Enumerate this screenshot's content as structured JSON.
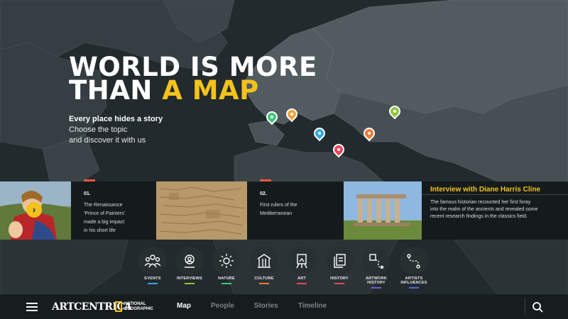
{
  "hero": {
    "title_line1": "WORLD IS MORE",
    "title_line2_prefix": "THAN",
    "title_line2_accent": "A MAP",
    "subtitle": "Every place hides a story",
    "desc_line1": "Choose the topic",
    "desc_line2": "and discover it with us"
  },
  "map_pins": [
    {
      "name": "pin-green",
      "color": "#3ec97a"
    },
    {
      "name": "pin-orange",
      "color": "#f4a340"
    },
    {
      "name": "pin-blue",
      "color": "#35a8e0"
    },
    {
      "name": "pin-red",
      "color": "#e8465a"
    },
    {
      "name": "pin-orange-east",
      "color": "#f07a3c"
    },
    {
      "name": "pin-green-east",
      "color": "#8cc63f"
    }
  ],
  "cards": [
    {
      "num": "01.",
      "text": [
        "The Renaissance",
        "'Prince of Painters'",
        "made a big impact",
        "in his short life"
      ],
      "tick_color": "#e85a3a"
    },
    {
      "num": "02.",
      "text": [
        "First rulers of the",
        "Mediterranean"
      ],
      "tick_color": "#e85a3a"
    }
  ],
  "interview": {
    "title": "Interview with Diane Harris Cline",
    "text": [
      "The famous historian recounted her first foray",
      "into the realm of the ancients and revealed some",
      "recent research findings in the classics field."
    ]
  },
  "topics": [
    {
      "label": [
        "EVENTS"
      ],
      "color": "#35a8e0",
      "icon": "people-icon"
    },
    {
      "label": [
        "INTERVIEWS"
      ],
      "color": "#8cc63f",
      "icon": "interview-icon"
    },
    {
      "label": [
        "NATURE"
      ],
      "color": "#3ec97a",
      "icon": "sun-icon"
    },
    {
      "label": [
        "CULTURE"
      ],
      "color": "#f07a3c",
      "icon": "building-icon"
    },
    {
      "label": [
        "ART"
      ],
      "color": "#e8465a",
      "icon": "easel-icon"
    },
    {
      "label": [
        "HISTORY"
      ],
      "color": "#e8465a",
      "icon": "scroll-icon"
    },
    {
      "label": [
        "ARTWORK",
        "HISTORY"
      ],
      "color": "#7a5bd6",
      "icon": "artwork-path-icon"
    },
    {
      "label": [
        "ARTISTS",
        "INFLUENCES"
      ],
      "color": "#4a6ee0",
      "icon": "path-icon"
    }
  ],
  "bottombar": {
    "brand": "ARTCENTRICA",
    "partner_line1": "NATIONAL",
    "partner_line2": "GEOGRAPHIC",
    "nav": [
      "Map",
      "People",
      "Stories",
      "Timeline"
    ],
    "active_nav": "Map"
  },
  "colors": {
    "accent": "#f4c21d",
    "background": "#222a2d"
  }
}
